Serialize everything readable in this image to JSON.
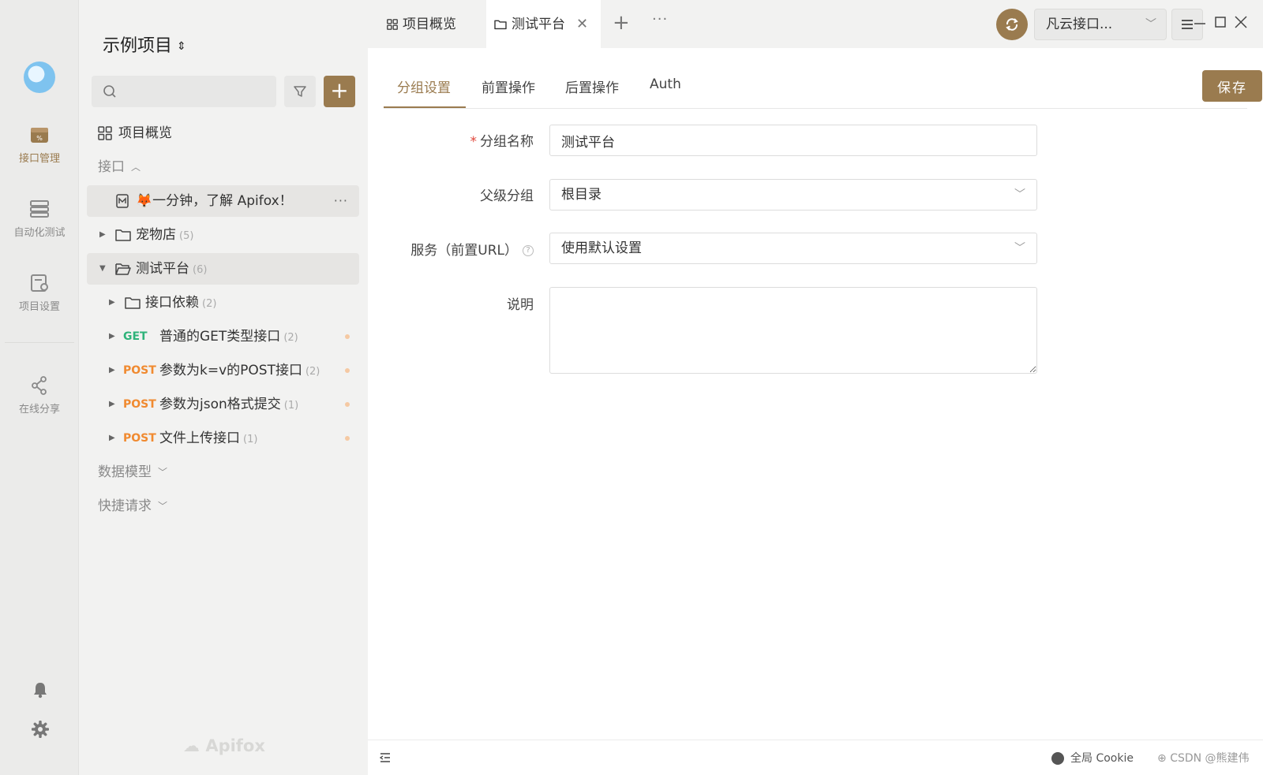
{
  "rail": {
    "items": [
      {
        "label": "接口管理",
        "icon": "api-management-icon",
        "active": true
      },
      {
        "label": "自动化测试",
        "icon": "automation-test-icon",
        "active": false
      },
      {
        "label": "项目设置",
        "icon": "project-settings-icon",
        "active": false
      },
      {
        "label": "在线分享",
        "icon": "share-icon",
        "active": false
      }
    ],
    "bottom_icons": [
      "bell-icon",
      "gear-icon"
    ]
  },
  "tree": {
    "project_title": "示例项目",
    "search_placeholder": "",
    "overview_label": "项目概览",
    "section_api": "接口",
    "intro_item": "🦊一分钟，了解 Apifox！",
    "pet_store": {
      "label": "宠物店",
      "count": "(5)"
    },
    "test_platform": {
      "label": "测试平台",
      "count": "(6)"
    },
    "dependency": {
      "label": "接口依赖",
      "count": "(2)"
    },
    "endpoints": [
      {
        "method": "GET",
        "label": "普通的GET类型接口",
        "count": "(2)"
      },
      {
        "method": "POST",
        "label": "参数为k=v的POST接口",
        "count": "(2)"
      },
      {
        "method": "POST",
        "label": "参数为json格式提交",
        "count": "(1)"
      },
      {
        "method": "POST",
        "label": "文件上传接口",
        "count": "(1)"
      }
    ],
    "section_models": "数据模型",
    "section_quick": "快捷请求",
    "watermark": "Apifox"
  },
  "topbar": {
    "tabs": [
      {
        "label": "项目概览",
        "active": false
      },
      {
        "label": "测试平台",
        "active": true
      }
    ],
    "env_select": "凡云接口...",
    "window_controls": [
      "minimize-icon",
      "maximize-icon",
      "close-icon"
    ]
  },
  "main": {
    "subtabs": [
      "分组设置",
      "前置操作",
      "后置操作",
      "Auth"
    ],
    "save_label": "保存",
    "form": {
      "group_name_label": "分组名称",
      "group_name_value": "测试平台",
      "parent_label": "父级分组",
      "parent_value": "根目录",
      "service_label": "服务（前置URL）",
      "service_value": "使用默认设置",
      "description_label": "说明",
      "description_value": ""
    }
  },
  "statusbar": {
    "cookie_label": "全局 Cookie",
    "watermark": "CSDN @熊建伟"
  },
  "colors": {
    "accent": "#9a7b4f",
    "get": "#2fb37a",
    "post": "#f08a30",
    "required": "#e0463a"
  }
}
